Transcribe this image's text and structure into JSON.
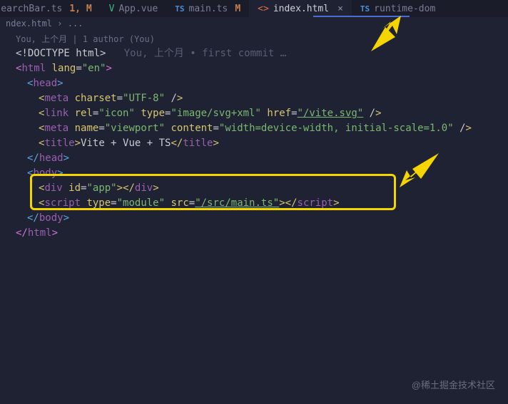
{
  "tabs": [
    {
      "icon": "TS",
      "name": "earchBar.ts",
      "badge": "1, M"
    },
    {
      "icon": "V",
      "name": "App.vue",
      "badge": ""
    },
    {
      "icon": "TS",
      "name": "main.ts",
      "badge": "M"
    },
    {
      "icon": "<>",
      "name": "index.html",
      "badge": "",
      "active": true,
      "close": "×"
    },
    {
      "icon": "TS",
      "name": "runtime-dom",
      "badge": ""
    }
  ],
  "breadcrumb": {
    "file": "ndex.html",
    "sep": "›",
    "rest": "..."
  },
  "codelens": "You, 上个月 | 1 author (You)",
  "inline_blame": "You, 上个月 • first commit …",
  "code": {
    "doctype": "<!DOCTYPE html>",
    "html_open_1": "<",
    "html_tag": "html",
    "html_lang_attr": " lang",
    "html_eq": "=",
    "html_lang_val": "\"en\"",
    "html_open_2": ">",
    "head_open": "head",
    "meta1_tag": "meta",
    "meta1_attr": " charset",
    "meta1_val": "\"UTF-8\"",
    "link_tag": "link",
    "link_rel": " rel",
    "link_rel_v": "\"icon\"",
    "link_type": " type",
    "link_type_v": "\"image/svg+xml\"",
    "link_href": " href",
    "link_href_v": "\"/vite.svg\"",
    "meta2_tag": "meta",
    "meta2_name": " name",
    "meta2_name_v": "\"viewport\"",
    "meta2_content": " content",
    "meta2_content_v": "\"width=device-width, initial-scale=1.0\"",
    "title_tag": "title",
    "title_text": "Vite + Vue + TS",
    "head_close": "head",
    "body_tag": "body",
    "div_tag": "div",
    "div_id": " id",
    "div_id_v": "\"app\"",
    "script_tag": "script",
    "script_type": " type",
    "script_type_v": "\"module\"",
    "script_src": " src",
    "script_src_v": "\"/src/main.ts\"",
    "body_close": "body",
    "html_close": "html"
  },
  "watermark": "@稀土掘金技术社区"
}
